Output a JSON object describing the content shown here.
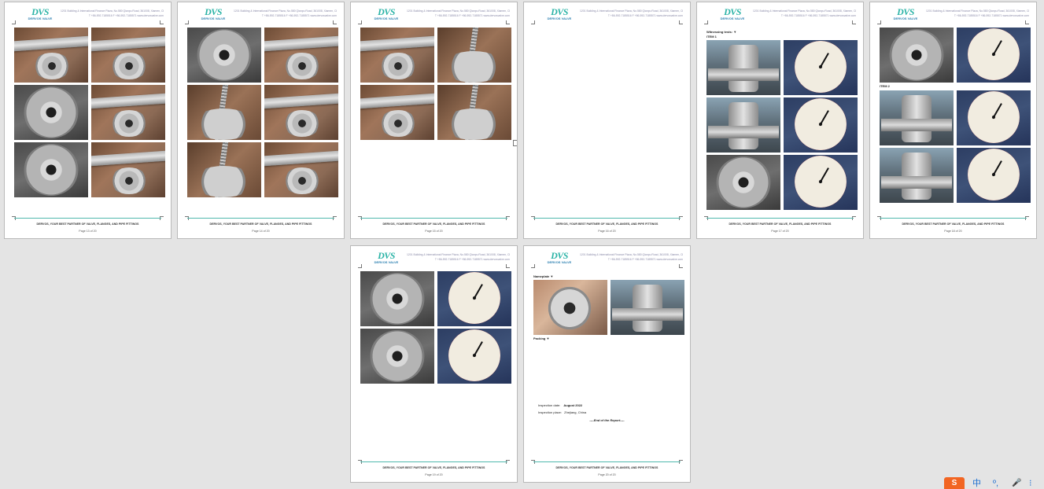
{
  "document": {
    "logo_mark": "DVS",
    "logo_sub": "DERVOS VALVE",
    "header_line1": "1201 Building & International Finance Plaza, No.580 Qianpu Road, 361008, Xiamen, China",
    "header_line2": "T +86-592-7185516   F +86-592-7185571   www.dervosvalve.com",
    "footer_text": "DERVOS, YOUR BEST PARTNER OF VALVE, FLANGES, AND PIPE FITTINGS"
  },
  "pages": [
    {
      "page_label": "Page 13 of 20"
    },
    {
      "page_label": "Page 14 of 20"
    },
    {
      "page_label": "Page 15 of 20"
    },
    {
      "page_label": "Page 16 of 20"
    },
    {
      "page_label": "Page 17 of 20",
      "section_title": "Witnessing tests: ▼",
      "item_label": "ITEM 1"
    },
    {
      "page_label": "Page 18 of 20",
      "item_label": "ITEM 2"
    },
    {
      "page_label": "Page 19 of 20"
    },
    {
      "page_label": "Page 20 of 20",
      "section_title": "Nameplate ▼",
      "section2_title": "Packing ▼",
      "inspection_date_label": "Inspection date:",
      "inspection_date_value": "August     2022",
      "inspection_place_label": "Inspection place:",
      "inspection_place_value": "Zhejiang, China",
      "end_of_report": "----End of the Report----"
    }
  ],
  "taskbar": {
    "ime_logo": "S",
    "ime_lang": "中",
    "ime_punct": "º,",
    "ime_mic": "🎤",
    "ime_more": "⁝"
  },
  "colors": {
    "workspace_bg": "#e4e4e4",
    "page_bg": "#ffffff",
    "brand_teal": "#2ab3a6",
    "ime_orange": "#f26522"
  }
}
